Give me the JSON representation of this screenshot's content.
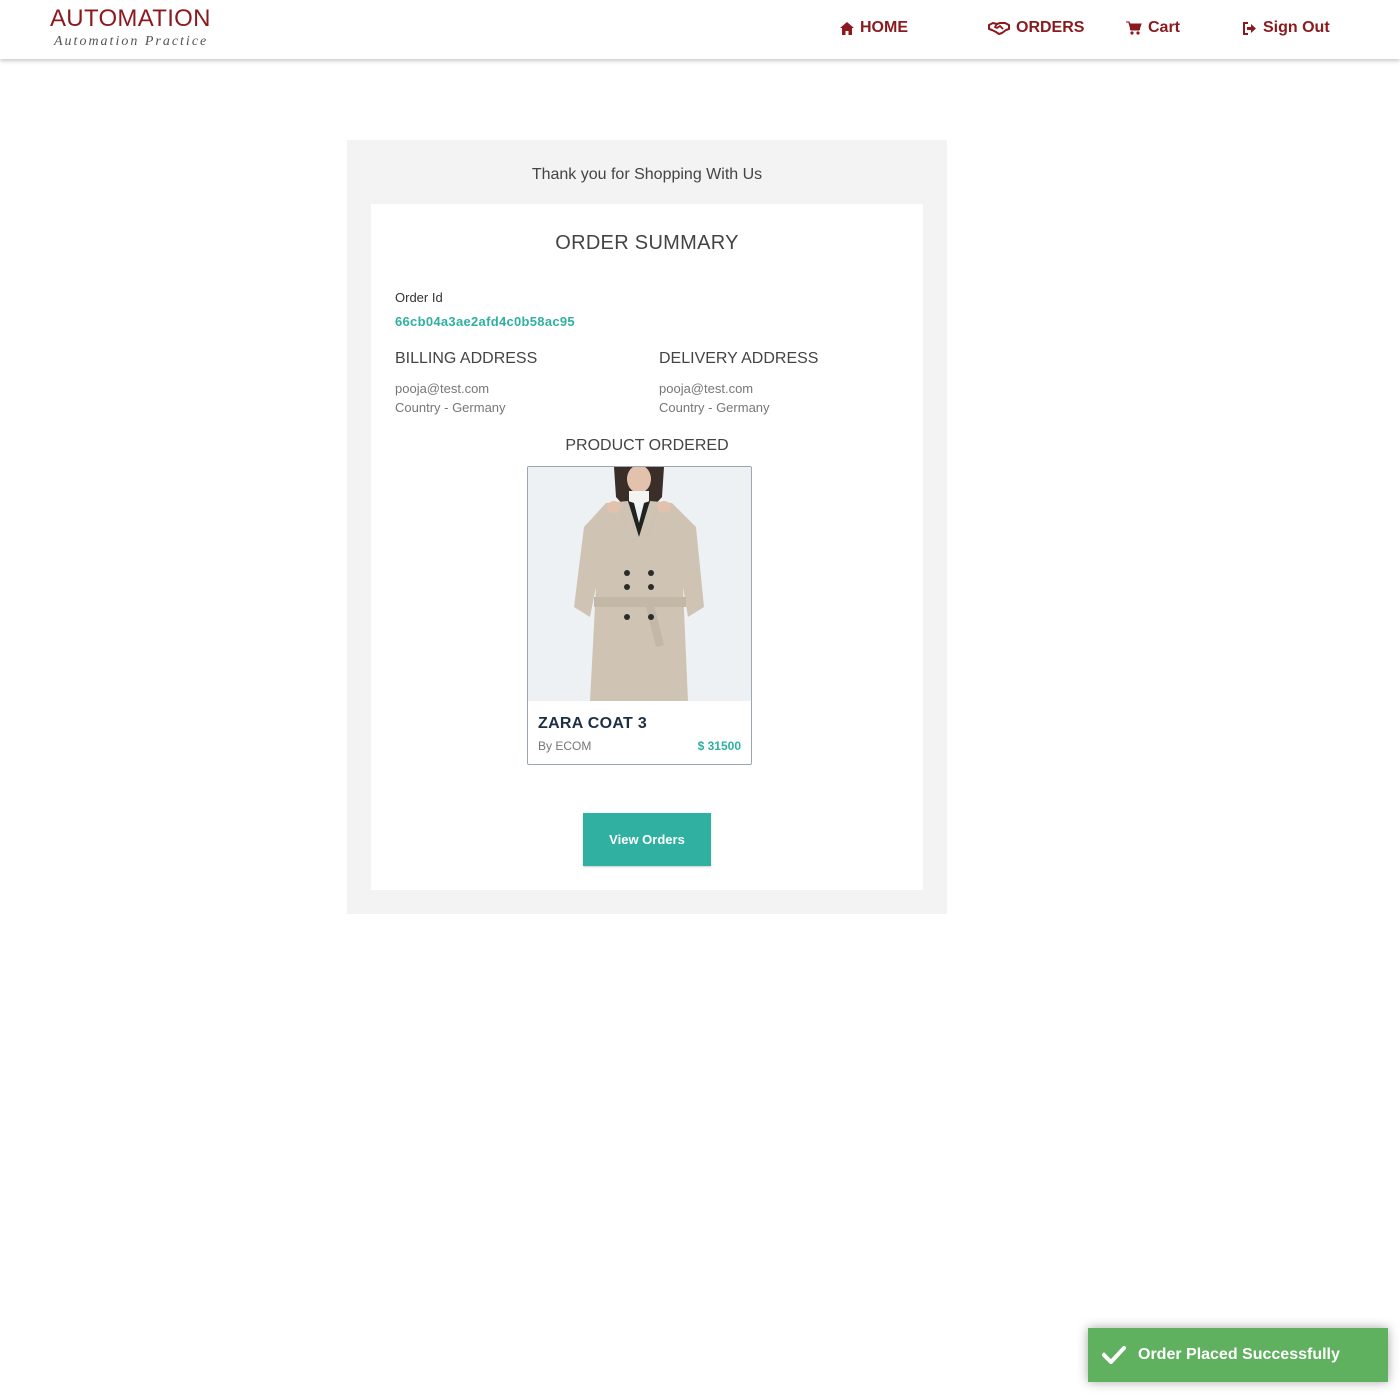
{
  "brand": {
    "title": "AUTOMATION",
    "subtitle": "Automation Practice"
  },
  "nav": {
    "home": "HOME",
    "orders": "ORDERS",
    "cart": "Cart",
    "signout": "Sign Out"
  },
  "main": {
    "thanks": "Thank you for Shopping With Us",
    "summary_title": "ORDER SUMMARY",
    "order_id_label": "Order Id",
    "order_id": "66cb04a3ae2afd4c0b58ac95",
    "billing": {
      "title": "BILLING ADDRESS",
      "email": "pooja@test.com",
      "country": "Country - Germany"
    },
    "delivery": {
      "title": "DELIVERY ADDRESS",
      "email": "pooja@test.com",
      "country": "Country - Germany"
    },
    "product_ordered_label": "PRODUCT ORDERED",
    "product": {
      "name": "ZARA COAT 3",
      "by": "By ECOM",
      "price": "$ 31500"
    },
    "view_orders_label": "View Orders"
  },
  "toast": {
    "message": "Order Placed Successfully"
  },
  "colors": {
    "brand": "#8b1a1f",
    "accent": "#2fb0a0",
    "toast": "#60b15f"
  },
  "icons": {
    "home": "home-icon",
    "orders": "handshake-icon",
    "cart": "cart-icon",
    "signout": "sign-out-icon",
    "toast": "check-icon"
  }
}
